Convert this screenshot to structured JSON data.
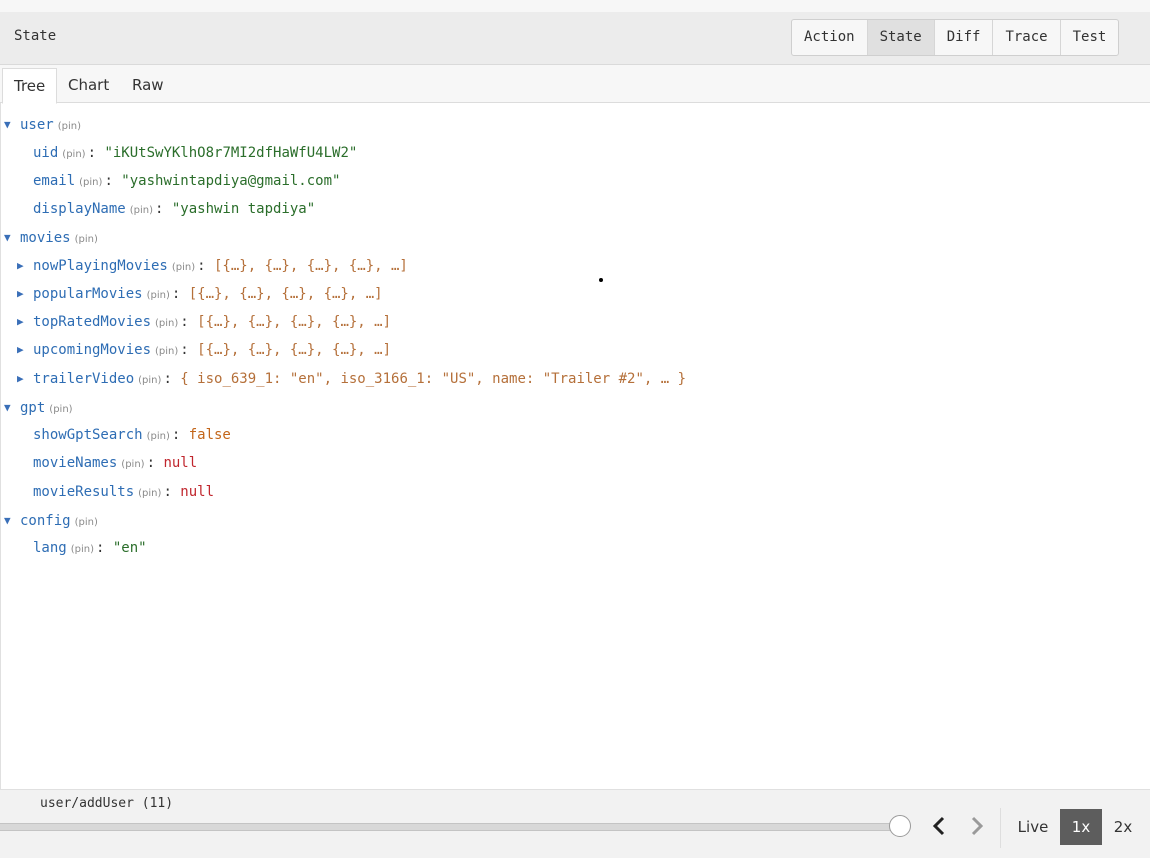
{
  "header": {
    "title": "State",
    "buttons": [
      {
        "label": "Action"
      },
      {
        "label": "State"
      },
      {
        "label": "Diff"
      },
      {
        "label": "Trace"
      },
      {
        "label": "Test"
      }
    ],
    "active_button": "State"
  },
  "tabs": [
    {
      "label": "Tree"
    },
    {
      "label": "Chart"
    },
    {
      "label": "Raw"
    }
  ],
  "active_tab": "Tree",
  "pin_label": "(pin)",
  "tree": {
    "user": {
      "key": "user",
      "uid": {
        "key": "uid",
        "value": "\"iKUtSwYKlhO8r7MI2dfHaWfU4LW2\""
      },
      "email": {
        "key": "email",
        "value": "\"yashwintapdiya@gmail.com\""
      },
      "displayName": {
        "key": "displayName",
        "value": "\"yashwin tapdiya\""
      }
    },
    "movies": {
      "key": "movies",
      "nowPlayingMovies": {
        "key": "nowPlayingMovies",
        "value": "[{…}, {…}, {…}, {…}, …]"
      },
      "popularMovies": {
        "key": "popularMovies",
        "value": "[{…}, {…}, {…}, {…}, …]"
      },
      "topRatedMovies": {
        "key": "topRatedMovies",
        "value": "[{…}, {…}, {…}, {…}, …]"
      },
      "upcomingMovies": {
        "key": "upcomingMovies",
        "value": "[{…}, {…}, {…}, {…}, …]"
      },
      "trailerVideo": {
        "key": "trailerVideo",
        "value": "{ iso_639_1: \"en\", iso_3166_1: \"US\", name: \"Trailer #2\", … }"
      }
    },
    "gpt": {
      "key": "gpt",
      "showGptSearch": {
        "key": "showGptSearch",
        "value": "false"
      },
      "movieNames": {
        "key": "movieNames",
        "value": "null"
      },
      "movieResults": {
        "key": "movieResults",
        "value": "null"
      }
    },
    "config": {
      "key": "config",
      "lang": {
        "key": "lang",
        "value": "\"en\""
      }
    }
  },
  "footer": {
    "action_label": "user/addUser (11)",
    "speeds": [
      {
        "label": "Live"
      },
      {
        "label": "1x"
      },
      {
        "label": "2x"
      }
    ],
    "active_speed": "1x",
    "slider_position": 1.0
  },
  "icons": {
    "expanded": "triangle-down-icon",
    "collapsed": "triangle-right-icon",
    "prev": "chevron-left-icon",
    "next": "chevron-right-icon"
  }
}
